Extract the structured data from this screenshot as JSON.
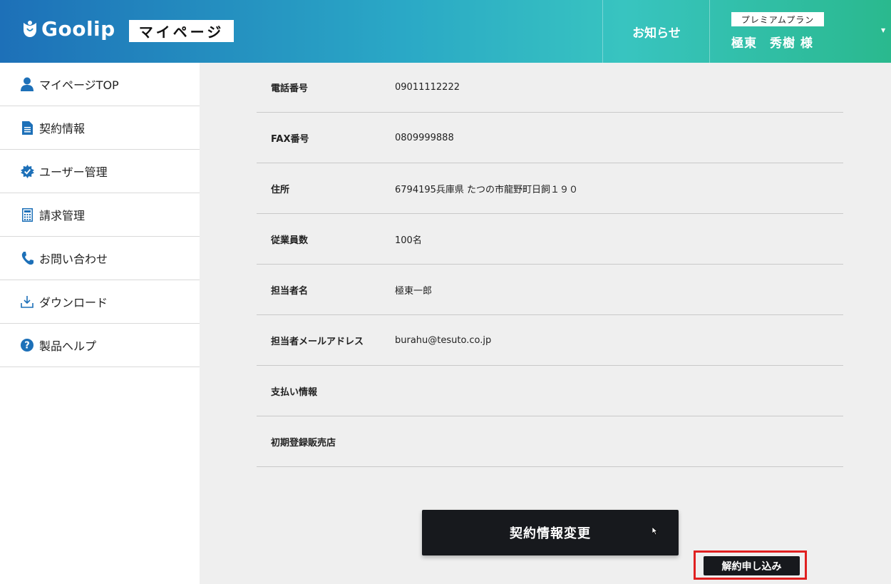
{
  "header": {
    "logo_text": "Goolip",
    "mypage_label": "マイページ",
    "notice_label": "お知らせ",
    "plan_badge": "プレミアムプラン",
    "user_name": "極東　秀樹 様",
    "colors": {
      "gradient_start": "#1d70b8",
      "gradient_end": "#2ab98e"
    }
  },
  "sidebar": {
    "items": [
      {
        "label": "マイページTOP",
        "icon": "user-icon"
      },
      {
        "label": "契約情報",
        "icon": "document-icon"
      },
      {
        "label": "ユーザー管理",
        "icon": "gear-icon"
      },
      {
        "label": "請求管理",
        "icon": "calculator-icon"
      },
      {
        "label": "お問い合わせ",
        "icon": "phone-icon"
      },
      {
        "label": "ダウンロード",
        "icon": "download-icon"
      },
      {
        "label": "製品ヘルプ",
        "icon": "help-icon"
      }
    ],
    "icon_color": "#1d70b8"
  },
  "contract": {
    "rows": [
      {
        "label": "電話番号",
        "value": "09011112222"
      },
      {
        "label": "FAX番号",
        "value": "0809999888"
      },
      {
        "label": "住所",
        "value": "6794195兵庫県 たつの市龍野町日飼１９０"
      },
      {
        "label": "従業員数",
        "value": "100名"
      },
      {
        "label": "担当者名",
        "value": "極東一郎"
      },
      {
        "label": "担当者メールアドレス",
        "value": "burahu@tesuto.co.jp"
      },
      {
        "label": "支払い情報",
        "value": ""
      },
      {
        "label": "初期登録販売店",
        "value": ""
      }
    ]
  },
  "actions": {
    "change_label": "契約情報変更",
    "cancel_label": "解約申し込み",
    "highlight_color": "#e02020"
  }
}
